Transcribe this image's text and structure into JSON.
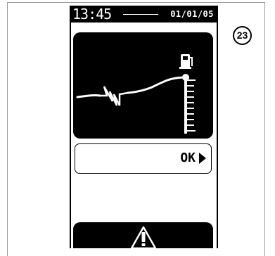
{
  "status_bar": {
    "time": "13:45",
    "date": "01/01/05"
  },
  "graph": {
    "icons": {
      "pump": "fuel-pump-icon",
      "break": "lightning-break-icon",
      "endpoint": "filled-dot-icon",
      "scale": "vertical-scale-icon"
    }
  },
  "ok_button": {
    "label": "OK"
  },
  "warning": {
    "icon": "warning-triangle-icon"
  },
  "step_badge": {
    "number": "23"
  },
  "colors": {
    "screen": "#000000",
    "foreground": "#ffffff",
    "frame": "#9a9a9a"
  }
}
